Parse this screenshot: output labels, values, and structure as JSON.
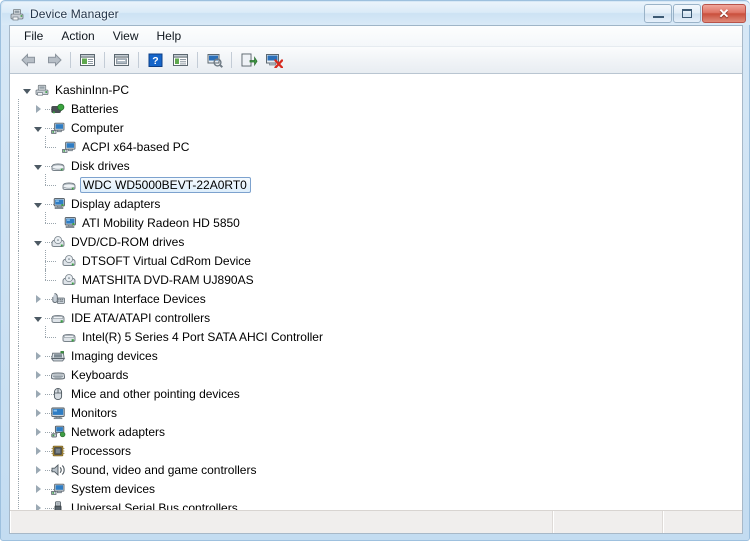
{
  "window": {
    "title": "Device Manager",
    "title_icon": "device-manager-icon",
    "minimize_label": "Minimize",
    "maximize_label": "Maximize",
    "close_label": "Close",
    "close_glyph": "✕"
  },
  "menu": {
    "items": [
      {
        "label": "File",
        "name": "menu-file"
      },
      {
        "label": "Action",
        "name": "menu-action"
      },
      {
        "label": "View",
        "name": "menu-view"
      },
      {
        "label": "Help",
        "name": "menu-help"
      }
    ]
  },
  "toolbar": {
    "buttons": [
      {
        "name": "back-button",
        "icon": "back-arrow-icon",
        "tooltip": "Back"
      },
      {
        "name": "forward-button",
        "icon": "forward-arrow-icon",
        "tooltip": "Forward"
      },
      {
        "name": "show-hide-console-tree-button",
        "icon": "console-tree-icon",
        "tooltip": "Show/Hide Console Tree"
      },
      {
        "name": "properties-button",
        "icon": "properties-icon",
        "tooltip": "Properties"
      },
      {
        "name": "help-button",
        "icon": "help-question-icon",
        "tooltip": "Help"
      },
      {
        "name": "view-button",
        "icon": "view-pane-icon",
        "tooltip": "View"
      },
      {
        "name": "scan-for-hardware-changes-button",
        "icon": "scan-hardware-icon",
        "tooltip": "Scan for hardware changes"
      },
      {
        "name": "update-driver-button",
        "icon": "update-driver-icon",
        "tooltip": "Update Driver Software"
      },
      {
        "name": "uninstall-button",
        "icon": "uninstall-device-icon",
        "tooltip": "Uninstall"
      }
    ]
  },
  "tree": {
    "nodes": [
      {
        "label": "KashinInn-PC",
        "depth": 0,
        "state": "expanded",
        "icon": "computer-root-icon",
        "selected": false
      },
      {
        "label": "Batteries",
        "depth": 1,
        "state": "collapsed",
        "icon": "battery-icon",
        "selected": false
      },
      {
        "label": "Computer",
        "depth": 1,
        "state": "expanded",
        "icon": "computer-icon",
        "selected": false
      },
      {
        "label": "ACPI x64-based PC",
        "depth": 2,
        "state": "leaf",
        "icon": "computer-icon",
        "selected": false
      },
      {
        "label": "Disk drives",
        "depth": 1,
        "state": "expanded",
        "icon": "disk-drive-icon",
        "selected": false
      },
      {
        "label": "WDC WD5000BEVT-22A0RT0",
        "depth": 2,
        "state": "leaf",
        "icon": "disk-drive-icon",
        "selected": true
      },
      {
        "label": "Display adapters",
        "depth": 1,
        "state": "expanded",
        "icon": "display-adapter-icon",
        "selected": false
      },
      {
        "label": "ATI Mobility Radeon HD 5850",
        "depth": 2,
        "state": "leaf",
        "icon": "display-adapter-icon",
        "selected": false
      },
      {
        "label": "DVD/CD-ROM drives",
        "depth": 1,
        "state": "expanded",
        "icon": "optical-drive-icon",
        "selected": false
      },
      {
        "label": "DTSOFT Virtual CdRom Device",
        "depth": 2,
        "state": "leaf",
        "icon": "optical-drive-icon",
        "selected": false
      },
      {
        "label": "MATSHITA DVD-RAM UJ890AS",
        "depth": 2,
        "state": "leaf",
        "icon": "optical-drive-icon",
        "selected": false
      },
      {
        "label": "Human Interface Devices",
        "depth": 1,
        "state": "collapsed",
        "icon": "hid-icon",
        "selected": false
      },
      {
        "label": "IDE ATA/ATAPI controllers",
        "depth": 1,
        "state": "expanded",
        "icon": "ide-controller-icon",
        "selected": false
      },
      {
        "label": "Intel(R) 5 Series 4 Port SATA AHCI Controller",
        "depth": 2,
        "state": "leaf",
        "icon": "ide-controller-icon",
        "selected": false
      },
      {
        "label": "Imaging devices",
        "depth": 1,
        "state": "collapsed",
        "icon": "imaging-device-icon",
        "selected": false
      },
      {
        "label": "Keyboards",
        "depth": 1,
        "state": "collapsed",
        "icon": "keyboard-icon",
        "selected": false
      },
      {
        "label": "Mice and other pointing devices",
        "depth": 1,
        "state": "collapsed",
        "icon": "mouse-icon",
        "selected": false
      },
      {
        "label": "Monitors",
        "depth": 1,
        "state": "collapsed",
        "icon": "monitor-icon",
        "selected": false
      },
      {
        "label": "Network adapters",
        "depth": 1,
        "state": "collapsed",
        "icon": "network-adapter-icon",
        "selected": false
      },
      {
        "label": "Processors",
        "depth": 1,
        "state": "collapsed",
        "icon": "processor-icon",
        "selected": false
      },
      {
        "label": "Sound, video and game controllers",
        "depth": 1,
        "state": "collapsed",
        "icon": "sound-controller-icon",
        "selected": false
      },
      {
        "label": "System devices",
        "depth": 1,
        "state": "collapsed",
        "icon": "system-device-icon",
        "selected": false
      },
      {
        "label": "Universal Serial Bus controllers",
        "depth": 1,
        "state": "collapsed",
        "icon": "usb-controller-icon",
        "selected": false
      }
    ]
  },
  "status_bar": {
    "pane_main": "",
    "pane_two": "",
    "pane_three": ""
  },
  "colors": {
    "selection_border": "#7da2ce",
    "selection_fill": "#ddeefb",
    "frame_glass": "#cfe3f4",
    "close_button": "#c94f3c"
  }
}
